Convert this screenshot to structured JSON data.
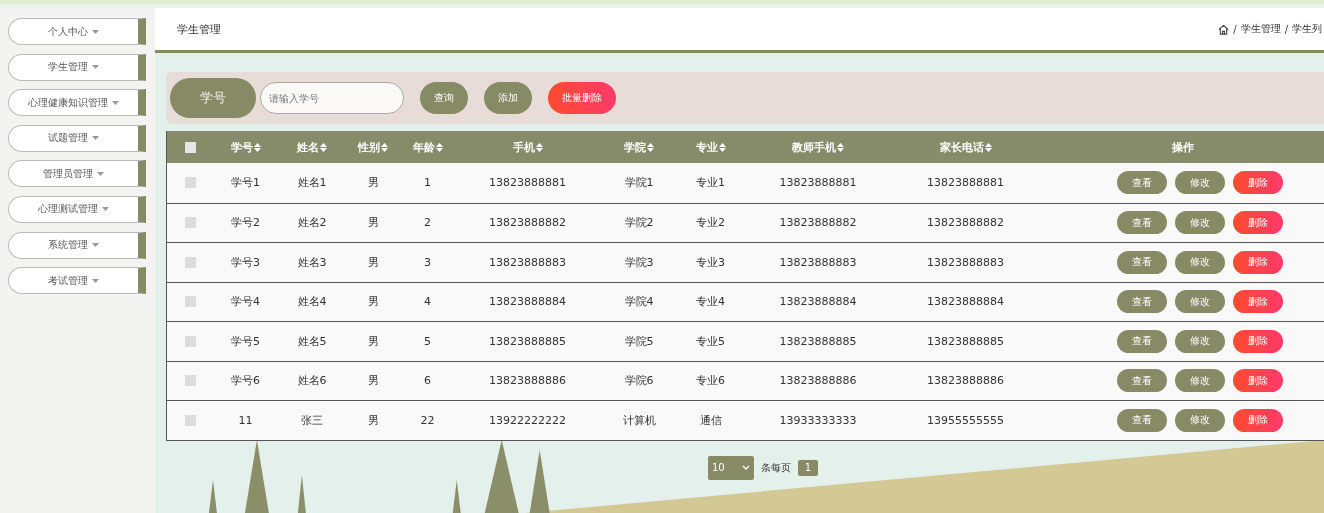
{
  "sidebar": {
    "items": [
      {
        "label": "个人中心",
        "selected": false
      },
      {
        "label": "学生管理",
        "selected": false
      },
      {
        "label": "心理健康知识管理",
        "selected": false
      },
      {
        "label": "试题管理",
        "selected": false
      },
      {
        "label": "管理员管理",
        "selected": false
      },
      {
        "label": "心理测试管理",
        "selected": false
      },
      {
        "label": "系统管理",
        "selected": false
      },
      {
        "label": "考试管理",
        "selected": false
      }
    ]
  },
  "header": {
    "title": "学生管理",
    "breadcrumb": [
      {
        "separator": "/",
        "label": "学生管理"
      },
      {
        "separator": "/",
        "label": "学生列"
      }
    ]
  },
  "search": {
    "label": "学号",
    "placeholder": "请输入学号",
    "buttons": [
      {
        "label": "查询",
        "kind": "normal"
      },
      {
        "label": "添加",
        "kind": "normal"
      },
      {
        "label": "批量删除",
        "kind": "danger"
      }
    ]
  },
  "table": {
    "select_all": {
      "checked": false
    },
    "columns": [
      {
        "label": "学号",
        "sortable": true
      },
      {
        "label": "姓名",
        "sortable": true
      },
      {
        "label": "性别",
        "sortable": true
      },
      {
        "label": "年龄",
        "sortable": true
      },
      {
        "label": "手机",
        "sortable": true
      },
      {
        "label": "学院",
        "sortable": true
      },
      {
        "label": "专业",
        "sortable": true
      },
      {
        "label": "教师手机",
        "sortable": true
      },
      {
        "label": "家长电话",
        "sortable": true
      },
      {
        "label": "操作",
        "sortable": false
      }
    ],
    "rows": [
      {
        "checked": false,
        "cells": [
          "学号1",
          "姓名1",
          "男",
          "1",
          "13823888881",
          "学院1",
          "专业1",
          "13823888881",
          "13823888881"
        ],
        "actions": [
          {
            "label": "查看",
            "kind": "normal"
          },
          {
            "label": "修改",
            "kind": "normal"
          },
          {
            "label": "删除",
            "kind": "danger"
          }
        ]
      },
      {
        "checked": false,
        "cells": [
          "学号2",
          "姓名2",
          "男",
          "2",
          "13823888882",
          "学院2",
          "专业2",
          "13823888882",
          "13823888882"
        ],
        "actions": [
          {
            "label": "查看",
            "kind": "normal"
          },
          {
            "label": "修改",
            "kind": "normal"
          },
          {
            "label": "删除",
            "kind": "danger"
          }
        ]
      },
      {
        "checked": false,
        "cells": [
          "学号3",
          "姓名3",
          "男",
          "3",
          "13823888883",
          "学院3",
          "专业3",
          "13823888883",
          "13823888883"
        ],
        "actions": [
          {
            "label": "查看",
            "kind": "normal"
          },
          {
            "label": "修改",
            "kind": "normal"
          },
          {
            "label": "删除",
            "kind": "danger"
          }
        ]
      },
      {
        "checked": false,
        "cells": [
          "学号4",
          "姓名4",
          "男",
          "4",
          "13823888884",
          "学院4",
          "专业4",
          "13823888884",
          "13823888884"
        ],
        "actions": [
          {
            "label": "查看",
            "kind": "normal"
          },
          {
            "label": "修改",
            "kind": "normal"
          },
          {
            "label": "删除",
            "kind": "danger"
          }
        ]
      },
      {
        "checked": false,
        "cells": [
          "学号5",
          "姓名5",
          "男",
          "5",
          "13823888885",
          "学院5",
          "专业5",
          "13823888885",
          "13823888885"
        ],
        "actions": [
          {
            "label": "查看",
            "kind": "normal"
          },
          {
            "label": "修改",
            "kind": "normal"
          },
          {
            "label": "删除",
            "kind": "danger"
          }
        ]
      },
      {
        "checked": false,
        "cells": [
          "学号6",
          "姓名6",
          "男",
          "6",
          "13823888886",
          "学院6",
          "专业6",
          "13823888886",
          "13823888886"
        ],
        "actions": [
          {
            "label": "查看",
            "kind": "normal"
          },
          {
            "label": "修改",
            "kind": "normal"
          },
          {
            "label": "删除",
            "kind": "danger"
          }
        ]
      },
      {
        "checked": false,
        "cells": [
          "11",
          "张三",
          "男",
          "22",
          "13922222222",
          "计算机",
          "通信",
          "13933333333",
          "13955555555"
        ],
        "actions": [
          {
            "label": "查看",
            "kind": "normal"
          },
          {
            "label": "修改",
            "kind": "normal"
          },
          {
            "label": "删除",
            "kind": "danger"
          }
        ]
      }
    ]
  },
  "pagination": {
    "page_size": "10",
    "per_page_label": "条每页",
    "pages": [
      {
        "label": "1",
        "selected": true
      }
    ]
  }
}
